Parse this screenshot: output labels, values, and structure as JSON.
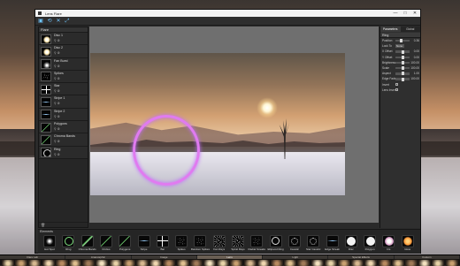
{
  "window": {
    "title": "Lens Flare",
    "controls": [
      "—",
      "□",
      "✕"
    ]
  },
  "toolbar": {
    "buttons": [
      {
        "icon": "paste-icon",
        "glyph": "▣"
      },
      {
        "icon": "reset-icon",
        "glyph": "⟲"
      },
      {
        "icon": "close-x-icon",
        "glyph": "✕"
      },
      {
        "icon": "fit-view-icon",
        "glyph": "⤢"
      }
    ]
  },
  "flares_panel": {
    "title": "Flare",
    "items": [
      {
        "name": "Disc 1",
        "thumb": "disc"
      },
      {
        "name": "Disc 2",
        "thumb": "disc"
      },
      {
        "name": "Fan Burst",
        "thumb": "glow"
      },
      {
        "name": "Spikes",
        "thumb": "spikes"
      },
      {
        "name": "Star",
        "thumb": "star"
      },
      {
        "name": "Stripe 1",
        "thumb": "stripe"
      },
      {
        "name": "Stripe 2",
        "thumb": "stripe"
      },
      {
        "name": "Polygons",
        "thumb": "dots"
      },
      {
        "name": "Chroma Bands",
        "thumb": "dots"
      },
      {
        "name": "Ring",
        "thumb": "ring"
      }
    ],
    "item_icons": "⚲ ⚙",
    "footer_icon": "🗑"
  },
  "parameters": {
    "tabs": [
      "Parameters",
      "Global"
    ],
    "active_tab": "Parameters",
    "section": "Ring",
    "rows": [
      {
        "label": "Position",
        "kind": "slider",
        "value": "0.36",
        "level": 0.36
      },
      {
        "label": "Lock To",
        "kind": "select",
        "value": "None"
      },
      {
        "label": "X Offset",
        "kind": "slider",
        "value": "0.00",
        "level": 0.5
      },
      {
        "label": "Y Offset",
        "kind": "slider",
        "value": "0.00",
        "level": 0.5
      },
      {
        "label": "Brightness",
        "kind": "slider",
        "value": "100.00",
        "level": 0.5
      },
      {
        "label": "Scale",
        "kind": "slider",
        "value": "100.00",
        "level": 0.5
      },
      {
        "label": "Aspect",
        "kind": "slider",
        "value": "1.00",
        "level": 0.5
      },
      {
        "label": "Edge Fade",
        "kind": "slider",
        "value": "100.00",
        "level": 0.5
      },
      {
        "label": "Invert",
        "kind": "checkbox",
        "value": ""
      },
      {
        "label": "Lens Invert",
        "kind": "checkbox",
        "value": ""
      }
    ]
  },
  "elements": {
    "title": "Elements",
    "items": [
      {
        "label": "Hot Spot",
        "thumb": "glow"
      },
      {
        "label": "Ring",
        "thumb": "ring-green"
      },
      {
        "label": "Chroma Bands",
        "thumb": "bands"
      },
      {
        "label": "Circles",
        "thumb": "dots"
      },
      {
        "label": "Polygons",
        "thumb": "dots"
      },
      {
        "label": "Stripe",
        "thumb": "stripe"
      },
      {
        "label": "Bar",
        "thumb": "star"
      },
      {
        "label": "Spikes",
        "thumb": "spikes"
      },
      {
        "label": "Random Spikes",
        "thumb": "spikes"
      },
      {
        "label": "Fan Rays",
        "thumb": "fan"
      },
      {
        "label": "Spiral Rays",
        "thumb": "fan"
      },
      {
        "label": "Radial Streaks",
        "thumb": "spikes"
      },
      {
        "label": "Ellipsoid Ring",
        "thumb": "ring"
      },
      {
        "label": "Caustic",
        "thumb": "caustic"
      },
      {
        "label": "Star Caustic",
        "thumb": "caustic"
      },
      {
        "label": "Edge Streak",
        "thumb": "stripe"
      },
      {
        "label": "Disc",
        "thumb": "white-disc"
      },
      {
        "label": "Polygon",
        "thumb": "white-disc"
      },
      {
        "label": "Iris",
        "thumb": "iris"
      },
      {
        "label": "Glow",
        "thumb": "orange-glow"
      }
    ]
  },
  "preset_strip": {
    "tabs": [
      "Flare Lab",
      "Anamorphic",
      "Image",
      "Lens",
      "Light",
      "Special Effects",
      "Custom"
    ],
    "active_tab": "Lens",
    "colors": [
      "#e8d3a8",
      "#c9a070",
      "#d8b890",
      "#f0d7b0",
      "#b88a60",
      "#e0c090",
      "#a07a58",
      "#f4e2c0"
    ]
  }
}
